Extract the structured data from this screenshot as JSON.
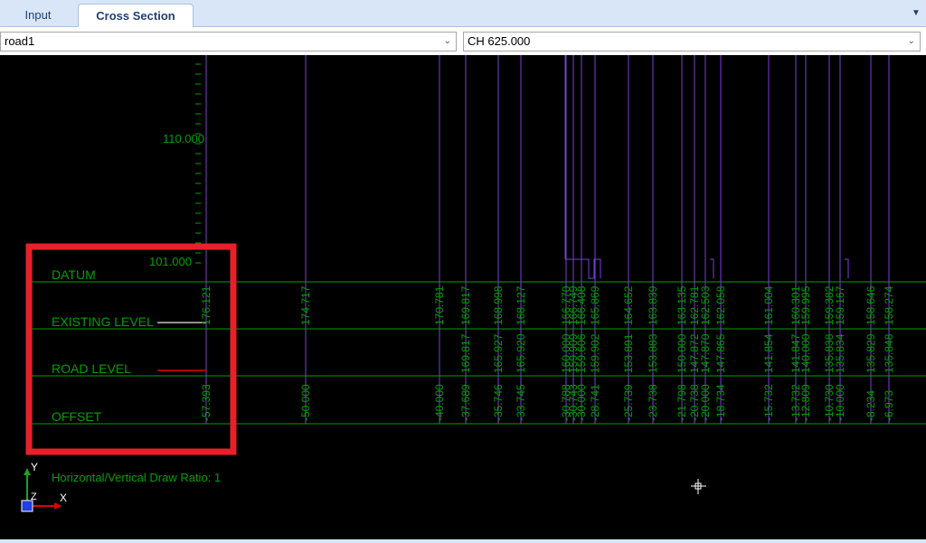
{
  "tabs": {
    "input_label": "Input",
    "cross_section_label": "Cross Section"
  },
  "selectors": {
    "road": "road1",
    "chainage": "CH 625.000"
  },
  "section": {
    "level_labels": [
      "110.000",
      "101.000"
    ],
    "row_labels": {
      "datum": "DATUM",
      "existing": "EXISTING LEVEL",
      "road": "ROAD LEVEL",
      "offset": "OFFSET"
    },
    "ratio_text": "Horizontal/Vertical Draw Ratio: 1",
    "axis_labels": {
      "y": "Y",
      "x": "X",
      "z": "Z"
    },
    "colors": {
      "grid_text": "#00a000",
      "section_line": "#7b3fd6",
      "highlight_box": "#e8202a",
      "existing_legend": "#c0c0c0",
      "road_legend": "#e00000"
    },
    "stations": [
      {
        "offset": "-57.393",
        "existing": "176.121",
        "road": "",
        "bottom": true
      },
      {
        "offset": "-50.000",
        "existing": "174.717",
        "road": ""
      },
      {
        "offset": "-40.000",
        "existing": "170.781",
        "road": ""
      },
      {
        "offset": "-37.689",
        "existing": "169.817",
        "road": "169.817"
      },
      {
        "offset": "-35.746",
        "existing": "168.998",
        "road": "165.927"
      },
      {
        "offset": "-33.745",
        "existing": "168.127",
        "road": "165.920"
      },
      {
        "offset": "-30.788",
        "existing": "166.770",
        "road": "160.000"
      },
      {
        "offset": "-30.743",
        "existing": "166.749",
        "road": "159.909"
      },
      {
        "offset": "-30.000",
        "existing": "166.408",
        "road": "159.606"
      },
      {
        "offset": "-28.741",
        "existing": "165.869",
        "road": "159.902"
      },
      {
        "offset": "-25.739",
        "existing": "164.652",
        "road": "153.891"
      },
      {
        "offset": "-23.738",
        "existing": "163.839",
        "road": "153.883"
      },
      {
        "offset": "-21.798",
        "existing": "163.135",
        "road": "150.000"
      },
      {
        "offset": "-20.738",
        "existing": "162.781",
        "road": "147.872"
      },
      {
        "offset": "-20.000",
        "existing": "162.503",
        "road": "147.870"
      },
      {
        "offset": "-18.734",
        "existing": "162.058",
        "road": "147.865"
      },
      {
        "offset": "-15.732",
        "existing": "161.004",
        "road": "141.854"
      },
      {
        "offset": "-13.732",
        "existing": "160.301",
        "road": "141.847"
      },
      {
        "offset": "-12.809",
        "existing": "159.995",
        "road": "140.000"
      },
      {
        "offset": "-10.730",
        "existing": "159.382",
        "road": "135.838"
      },
      {
        "offset": "-10.000",
        "existing": "159.167",
        "road": "135.834"
      },
      {
        "offset": "-8.234",
        "existing": "158.646",
        "road": "135.829"
      },
      {
        "offset": "-6.973",
        "existing": "158.274",
        "road": "135.848"
      }
    ]
  }
}
